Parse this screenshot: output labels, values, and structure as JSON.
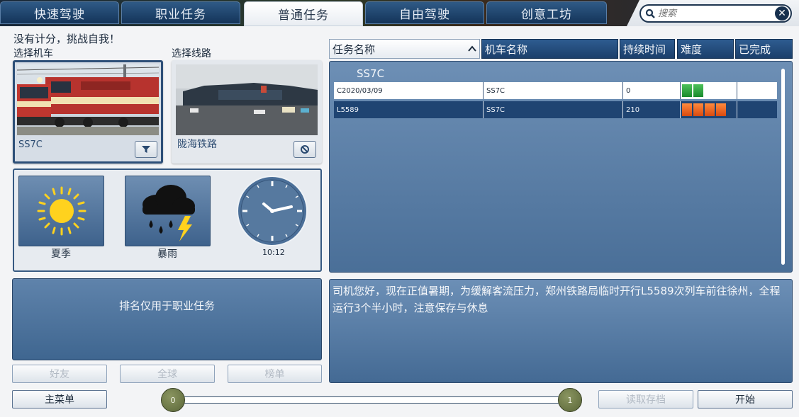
{
  "tabs": [
    "快速驾驶",
    "职业任务",
    "普通任务",
    "自由驾驶",
    "创意工坊"
  ],
  "active_tab": "普通任务",
  "search": {
    "placeholder": "搜索"
  },
  "left": {
    "headline": "没有计分，挑战自我！",
    "locomotive_label": "选择机车",
    "route_label": "选择线路",
    "locomotive_name": "SS7C",
    "route_name": "陇海铁路"
  },
  "environment": {
    "season": "夏季",
    "weather": "暴雨",
    "time": "10:12"
  },
  "ranking": {
    "message": "排名仅用于职业任务",
    "friends": "好友",
    "global": "全球",
    "leaderboard": "榜单"
  },
  "bottom": {
    "main_menu": "主菜单",
    "slider_min": "0",
    "slider_max": "1",
    "load_save": "读取存档",
    "start": "开始"
  },
  "table": {
    "headers": [
      "任务名称",
      "机车名称",
      "持续时间",
      "难度",
      "已完成"
    ],
    "group": "SS7C",
    "rows": [
      {
        "task": "C2020/03/09",
        "loco": "SS7C",
        "duration": "0",
        "difficulty": 2,
        "done": ""
      },
      {
        "task": "L5589",
        "loco": "SS7C",
        "duration": "210",
        "difficulty": 4,
        "done": ""
      }
    ]
  },
  "description": "司机您好，现在正值暑期，为缓解客流压力，郑州铁路局临时开行L5589次列车前往徐州，全程运行3个半小时，注意保存与休息",
  "colors": {
    "accent": "#2d4f78",
    "panel": "#5f83ab",
    "difficulty_easy": "#2aa83c",
    "difficulty_hard": "#f06a22"
  }
}
